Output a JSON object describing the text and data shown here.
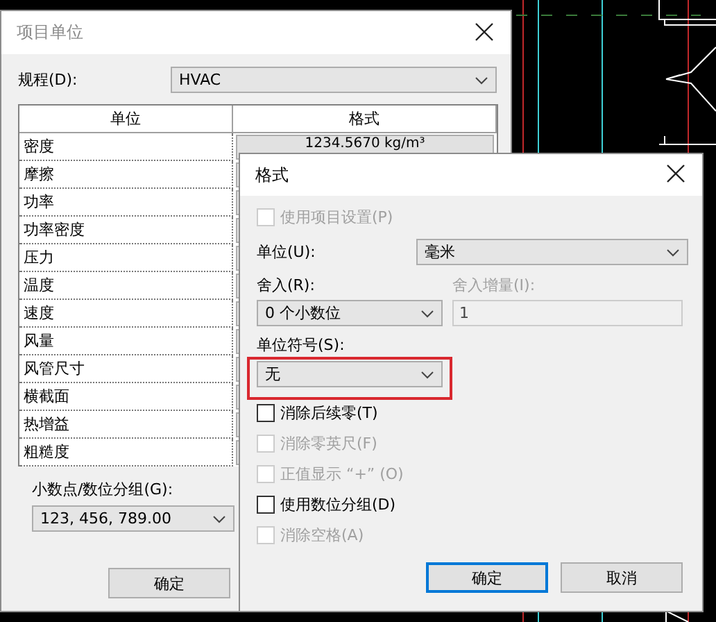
{
  "main_dialog": {
    "title": "项目单位",
    "discipline": {
      "label": "规程(D):",
      "value": "HVAC"
    },
    "table": {
      "columns": [
        "单位",
        "格式"
      ],
      "rows": [
        {
          "unit": "密度",
          "format": "1234.5670 kg/m³"
        },
        {
          "unit": "摩擦"
        },
        {
          "unit": "功率"
        },
        {
          "unit": "功率密度"
        },
        {
          "unit": "压力"
        },
        {
          "unit": "温度"
        },
        {
          "unit": "速度"
        },
        {
          "unit": "风量"
        },
        {
          "unit": "风管尺寸"
        },
        {
          "unit": "横截面"
        },
        {
          "unit": "热增益"
        },
        {
          "unit": "粗糙度"
        }
      ]
    },
    "decimal_grouping": {
      "label": "小数点/数位分组(G):",
      "value": "123, 456, 789.00"
    },
    "buttons": [
      "确定"
    ]
  },
  "format_dialog": {
    "title": "格式",
    "use_project_settings": {
      "label": "使用项目设置(P)",
      "checked": false,
      "disabled": true
    },
    "unit": {
      "label": "单位(U):",
      "value": "毫米"
    },
    "rounding": {
      "label": "舍入(R):",
      "value": "0 个小数位"
    },
    "rounding_increment": {
      "label": "舍入增量(I):",
      "value": "1",
      "disabled": true
    },
    "unit_symbol": {
      "label": "单位符号(S):",
      "value": "无",
      "highlighted": true
    },
    "options": [
      {
        "label": "消除后续零(T)",
        "checked": false,
        "disabled": false
      },
      {
        "label": "消除零英尺(F)",
        "checked": false,
        "disabled": true
      },
      {
        "label": "正值显示 “+” (O)",
        "checked": false,
        "disabled": true
      },
      {
        "label": "使用数位分组(D)",
        "checked": false,
        "disabled": false
      },
      {
        "label": "消除空格(A)",
        "checked": false,
        "disabled": true
      }
    ],
    "buttons": [
      {
        "label": "确定",
        "focused": true
      },
      {
        "label": "取消",
        "focused": false
      }
    ]
  }
}
